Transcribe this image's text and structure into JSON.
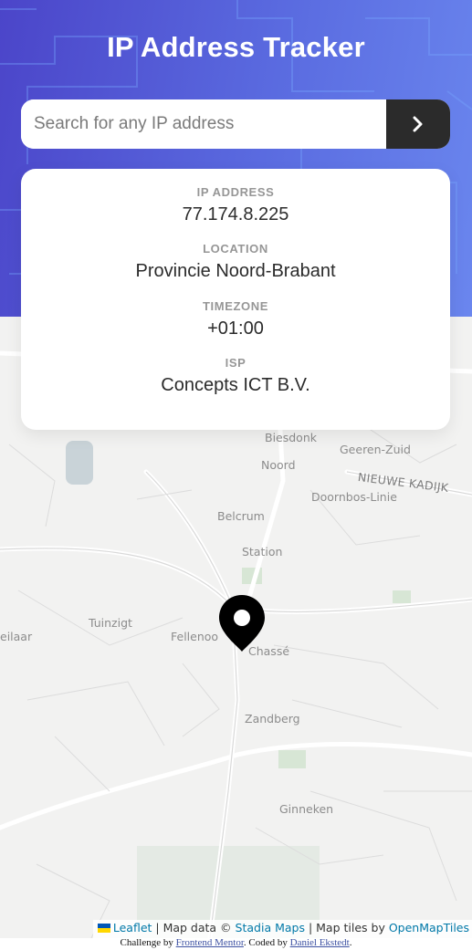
{
  "header": {
    "title": "IP Address Tracker"
  },
  "search": {
    "placeholder": "Search for any IP address",
    "value": "",
    "button_icon": "chevron-right-icon"
  },
  "info": {
    "ip": {
      "label": "IP ADDRESS",
      "value": "77.174.8.225"
    },
    "location": {
      "label": "LOCATION",
      "value": "Provincie Noord-Brabant"
    },
    "timezone": {
      "label": "TIMEZONE",
      "value": "+01:00"
    },
    "isp": {
      "label": "ISP",
      "value": "Concepts ICT B.V."
    }
  },
  "map": {
    "labels": {
      "biesdonk": "Biesdonk",
      "geeren_zuid": "Geeren-Zuid",
      "noord": "Noord",
      "nieuwe_kadijk": "NIEUWE KADIJK",
      "doornbos_linie": "Doornbos-Linie",
      "belcrum": "Belcrum",
      "station": "Station",
      "tuinzigt": "Tuinzigt",
      "eilaar": "eilaar",
      "fellenoord": "Fellenoo",
      "chasse": "Chassé",
      "zandberg": "Zandberg",
      "ginneken": "Ginneken"
    },
    "marker_icon": "location-pin-icon"
  },
  "attribution": {
    "leaflet": "Leaflet",
    "sep1": " | Map data © ",
    "stadia": "Stadia Maps",
    "sep2": " | Map tiles by ",
    "openmaptiles": "OpenMapTiles"
  },
  "footer": {
    "prefix": "Challenge by ",
    "frontend_mentor": "Frontend Mentor",
    "middle": ". Coded by ",
    "author": "Daniel Ekstedt",
    "suffix": "."
  },
  "colors": {
    "hero_gradient_start": "#4b45c9",
    "hero_gradient_end": "#6a86ee",
    "button_dark": "#2b2b2b",
    "label_gray": "#969696",
    "link_blue": "#0078a8"
  }
}
